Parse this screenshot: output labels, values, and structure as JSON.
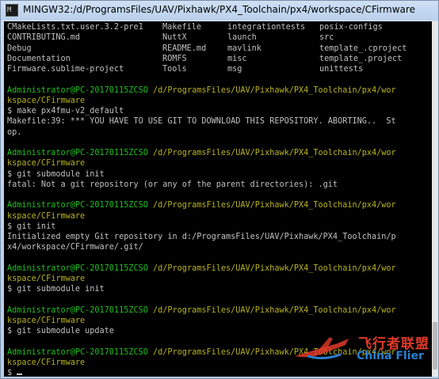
{
  "window": {
    "title": "MINGW32:/d/ProgramsFiles/UAV/Pixhawk/PX4_Toolchain/px4/workspace/CFirmware",
    "icon": "terminal-icon",
    "icon_glyph": "M"
  },
  "terminal": {
    "colors": {
      "background": "#000000",
      "text": "#c0c0c0",
      "prompt": "#1fbf1f",
      "path": "#b8b31f"
    },
    "listing": [
      [
        "CMakeLists.txt.user.3.2-pre1",
        "Makefile",
        "integrationtests",
        "posix-configs"
      ],
      [
        "CONTRIBUTING.md",
        "NuttX",
        "launch",
        "src"
      ],
      [
        "Debug",
        "README.md",
        "mavlink",
        "template_.cproject"
      ],
      [
        "Documentation",
        "ROMFS",
        "misc",
        "template_.project"
      ],
      [
        "Firmware.sublime-project",
        "Tools",
        "msg",
        "unittests"
      ]
    ],
    "lines": [
      {
        "type": "blank"
      },
      {
        "type": "prompt",
        "user": "Administrator@PC-20170115ZCSO",
        "path": " /d/ProgramsFiles/UAV/Pixhawk/PX4_Toolchain/px4/wor"
      },
      {
        "type": "path",
        "text": "kspace/CFirmware"
      },
      {
        "type": "text",
        "text": "$ make px4fmu-v2_default"
      },
      {
        "type": "text",
        "text": "Makefile:39: *** YOU HAVE TO USE GIT TO DOWNLOAD THIS REPOSITORY. ABORTING..  St"
      },
      {
        "type": "text",
        "text": "op."
      },
      {
        "type": "blank"
      },
      {
        "type": "prompt",
        "user": "Administrator@PC-20170115ZCSO",
        "path": " /d/ProgramsFiles/UAV/Pixhawk/PX4_Toolchain/px4/wor"
      },
      {
        "type": "path",
        "text": "kspace/CFirmware"
      },
      {
        "type": "text",
        "text": "$ git submodule init"
      },
      {
        "type": "text",
        "text": "fatal: Not a git repository (or any of the parent directories): .git"
      },
      {
        "type": "blank"
      },
      {
        "type": "prompt",
        "user": "Administrator@PC-20170115ZCSO",
        "path": " /d/ProgramsFiles/UAV/Pixhawk/PX4_Toolchain/px4/wor"
      },
      {
        "type": "path",
        "text": "kspace/CFirmware"
      },
      {
        "type": "text",
        "text": "$ git init"
      },
      {
        "type": "text",
        "text": "Initialized empty Git repository in d:/ProgramsFiles/UAV/Pixhawk/PX4_Toolchain/p"
      },
      {
        "type": "text",
        "text": "x4/workspace/CFirmware/.git/"
      },
      {
        "type": "blank"
      },
      {
        "type": "prompt",
        "user": "Administrator@PC-20170115ZCSO",
        "path": " /d/ProgramsFiles/UAV/Pixhawk/PX4_Toolchain/px4/wor"
      },
      {
        "type": "path",
        "text": "kspace/CFirmware"
      },
      {
        "type": "text",
        "text": "$ git submodule init"
      },
      {
        "type": "blank"
      },
      {
        "type": "prompt",
        "user": "Administrator@PC-20170115ZCSO",
        "path": " /d/ProgramsFiles/UAV/Pixhawk/PX4_Toolchain/px4/wor"
      },
      {
        "type": "path",
        "text": "kspace/CFirmware"
      },
      {
        "type": "text",
        "text": "$ git submodule update"
      },
      {
        "type": "blank"
      },
      {
        "type": "prompt",
        "user": "Administrator@PC-20170115ZCSO",
        "path": " /d/ProgramsFiles/UAV/Pixhawk/PX4_Toolchain/px4/wor"
      },
      {
        "type": "path",
        "text": "kspace/CFirmware"
      },
      {
        "type": "input",
        "text": "$ "
      }
    ]
  },
  "watermark": {
    "chinese": "飞行者联盟",
    "english": "China Flier"
  }
}
